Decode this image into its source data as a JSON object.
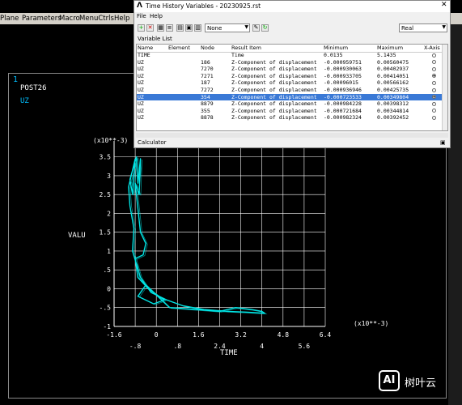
{
  "main_menu": [
    "Plane",
    "Parameters",
    "Macro",
    "MenuCtrls",
    "Help"
  ],
  "graphics": {
    "window_number": "1",
    "title": "POST26",
    "variable": "UZ",
    "y_multiplier": "(x10**-3)",
    "x_multiplier": "(x10**-3)",
    "ylabel": "VALU",
    "xlabel": "TIME"
  },
  "dialog": {
    "title": "Time History Variables - 20230925.rst",
    "menu": [
      "File",
      "Help"
    ],
    "variable_list_label": "Variable List",
    "dropdown_none": "None",
    "dropdown_real": "Real",
    "calculator_label": "Calculator",
    "columns": [
      "Name",
      "Element",
      "Node",
      "Result Item",
      "Minimum",
      "Maximum",
      "X-Axis"
    ],
    "rows": [
      {
        "name": "TIME",
        "element": "",
        "node": "",
        "item": "Time",
        "min": "0.0135",
        "max": "5.1435",
        "xaxis": "off"
      },
      {
        "name": "UZ",
        "element": "",
        "node": "186",
        "item": "Z-Component of displacement",
        "min": "-0.000959751",
        "max": "0.00560475",
        "xaxis": "off"
      },
      {
        "name": "UZ",
        "element": "",
        "node": "7270",
        "item": "Z-Component of displacement",
        "min": "-0.000930063",
        "max": "0.00402937",
        "xaxis": "off"
      },
      {
        "name": "UZ",
        "element": "",
        "node": "7271",
        "item": "Z-Component of displacement",
        "min": "-0.000933705",
        "max": "0.00414051",
        "xaxis": "on"
      },
      {
        "name": "UZ",
        "element": "",
        "node": "187",
        "item": "Z-Component of displacement",
        "min": "-0.00096015",
        "max": "0.00566162",
        "xaxis": "off"
      },
      {
        "name": "UZ",
        "element": "",
        "node": "7272",
        "item": "Z-Component of displacement",
        "min": "-0.000936946",
        "max": "0.00425735",
        "xaxis": "off"
      },
      {
        "name": "UZ",
        "element": "",
        "node": "354",
        "item": "Z-Component of displacement",
        "min": "-0.000723533",
        "max": "0.00349804",
        "xaxis": "on",
        "selected": true
      },
      {
        "name": "UZ",
        "element": "",
        "node": "8879",
        "item": "Z-Component of displacement",
        "min": "-0.000984228",
        "max": "0.00398312",
        "xaxis": "off"
      },
      {
        "name": "UZ",
        "element": "",
        "node": "355",
        "item": "Z-Component of displacement",
        "min": "-0.000721684",
        "max": "0.00344814",
        "xaxis": "off"
      },
      {
        "name": "UZ",
        "element": "",
        "node": "8878",
        "item": "Z-Component of displacement",
        "min": "-0.000982324",
        "max": "0.00392452",
        "xaxis": "off"
      }
    ]
  },
  "chart_data": {
    "type": "line",
    "xlabel": "TIME",
    "ylabel": "VALU",
    "x_ticks_upper": [
      "-1.6",
      "0",
      "1.6",
      "3.2",
      "4.8",
      "6.4"
    ],
    "x_ticks_lower": [
      "-.8",
      ".8",
      "2.4",
      "4",
      "5.6"
    ],
    "y_ticks": [
      "3.5",
      "3",
      "2.5",
      "2",
      "1.5",
      "1",
      ".5",
      "0",
      "-.5",
      "-1"
    ],
    "xlim": [
      -1.6,
      6.4
    ],
    "ylim": [
      -1,
      3.75
    ],
    "series": [
      {
        "color": "#00e5e5",
        "x": [
          -0.8,
          -0.9,
          -1.0,
          -0.75,
          -0.7,
          -0.6,
          -0.65,
          -0.8,
          -0.6,
          -0.4,
          -0.5,
          -0.8,
          -0.7,
          -0.3,
          0.1,
          0.3,
          -0.1,
          -0.7,
          -0.4,
          0.5,
          1.5,
          2.4,
          3.0,
          3.6,
          4.0,
          4.1,
          3.4,
          2.7,
          1.8,
          1.0,
          0.4,
          -0.2,
          -0.6,
          -0.9,
          -0.85,
          -1.0,
          -1.05,
          -0.8
        ],
        "y": [
          3.45,
          2.5,
          2.9,
          3.5,
          2.8,
          3.45,
          2.5,
          2.8,
          1.5,
          1.2,
          0.9,
          0.8,
          0.3,
          0.0,
          -0.2,
          -0.3,
          -0.4,
          -0.2,
          0.1,
          -0.5,
          -0.55,
          -0.6,
          -0.5,
          -0.55,
          -0.6,
          -0.65,
          -0.62,
          -0.6,
          -0.55,
          -0.45,
          -0.3,
          -0.1,
          0.3,
          1.0,
          1.6,
          2.2,
          2.7,
          3.45
        ]
      }
    ]
  },
  "watermark": {
    "logo": "AI",
    "text": "树叶云"
  }
}
